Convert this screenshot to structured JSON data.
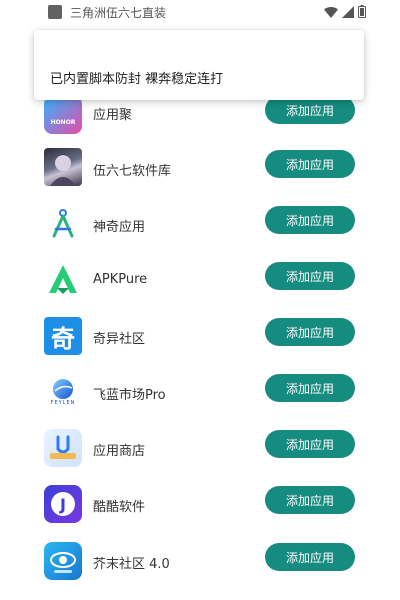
{
  "status_bar": {
    "title": "三角洲伍六七直装",
    "icons": [
      "app-icon",
      "wifi-icon",
      "signal-icon",
      "battery-icon"
    ]
  },
  "toast": {
    "message": "已内置脚本防封 裸奔稳定连打"
  },
  "apps": [
    {
      "name": "应用聚",
      "button": "添加应用",
      "icon": "yingyongju-icon",
      "icon_text": "HONOR"
    },
    {
      "name": "伍六七软件库",
      "button": "添加应用",
      "icon": "wuliuqi-avatar-icon"
    },
    {
      "name": "神奇应用",
      "button": "添加应用",
      "icon": "compass-drafting-icon"
    },
    {
      "name": "APKPure",
      "button": "添加应用",
      "icon": "apkpure-icon"
    },
    {
      "name": "奇异社区",
      "button": "添加应用",
      "icon": "qiyi-icon",
      "icon_text": "奇"
    },
    {
      "name": "飞蓝市场Pro",
      "button": "添加应用",
      "icon": "feilan-icon",
      "icon_text": "FEYLEN"
    },
    {
      "name": "应用商店",
      "button": "添加应用",
      "icon": "app-store-icon"
    },
    {
      "name": "酷酷软件",
      "button": "添加应用",
      "icon": "kuku-icon",
      "icon_text": "J"
    },
    {
      "name": "芥末社区 4.0",
      "button": "添加应用",
      "icon": "jiemo-icon"
    }
  ],
  "colors": {
    "button_bg": "#158c7f",
    "button_text": "#ffffff",
    "toast_bg": "#ffffff"
  }
}
